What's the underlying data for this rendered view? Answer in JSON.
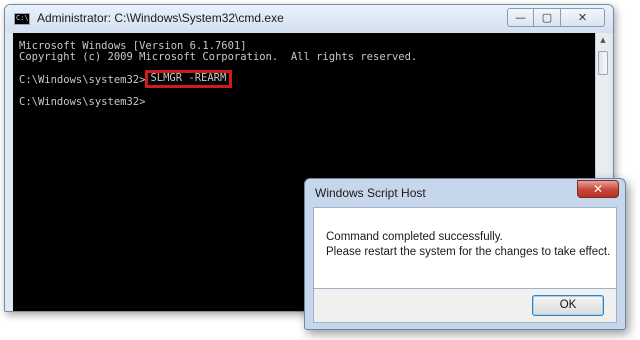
{
  "cmd_window": {
    "title": "Administrator: C:\\Windows\\System32\\cmd.exe",
    "icon_text": "C:\\",
    "buttons": {
      "minimize": "—",
      "maximize": "▢",
      "close": "✕"
    },
    "console": {
      "line1": "Microsoft Windows [Version 6.1.7601]",
      "line2": "Copyright (c) 2009 Microsoft Corporation.  All rights reserved.",
      "prompt1": "C:\\Windows\\system32>",
      "command": "SLMGR -REARM",
      "prompt2": "C:\\Windows\\system32>"
    }
  },
  "dialog": {
    "title": "Windows Script Host",
    "close_label": "✕",
    "message_line1": "Command completed successfully.",
    "message_line2": "Please restart the system for the changes to take effect.",
    "ok_label": "OK"
  },
  "colors": {
    "highlight_border": "#d11a1a",
    "console_bg": "#000000",
    "console_text": "#c8c8c8"
  }
}
